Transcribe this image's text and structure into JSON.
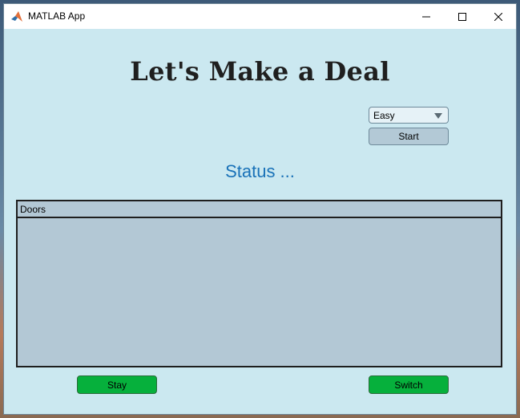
{
  "window": {
    "title": "MATLAB App",
    "icon": "matlab-icon",
    "controls": [
      "minimize-icon",
      "maximize-icon",
      "close-icon"
    ]
  },
  "main": {
    "title": "Let's Make a Deal",
    "difficulty": {
      "selected": "Easy"
    },
    "start_label": "Start",
    "status_text": "Status ...",
    "doors_panel": {
      "title": "Doors"
    },
    "stay_label": "Stay",
    "switch_label": "Switch"
  },
  "colors": {
    "background": "#cbe8f0",
    "status_text": "#1a72b8",
    "panel": "#b3c8d5",
    "action_button": "#06b03c",
    "start_button": "#b3c9d6"
  }
}
